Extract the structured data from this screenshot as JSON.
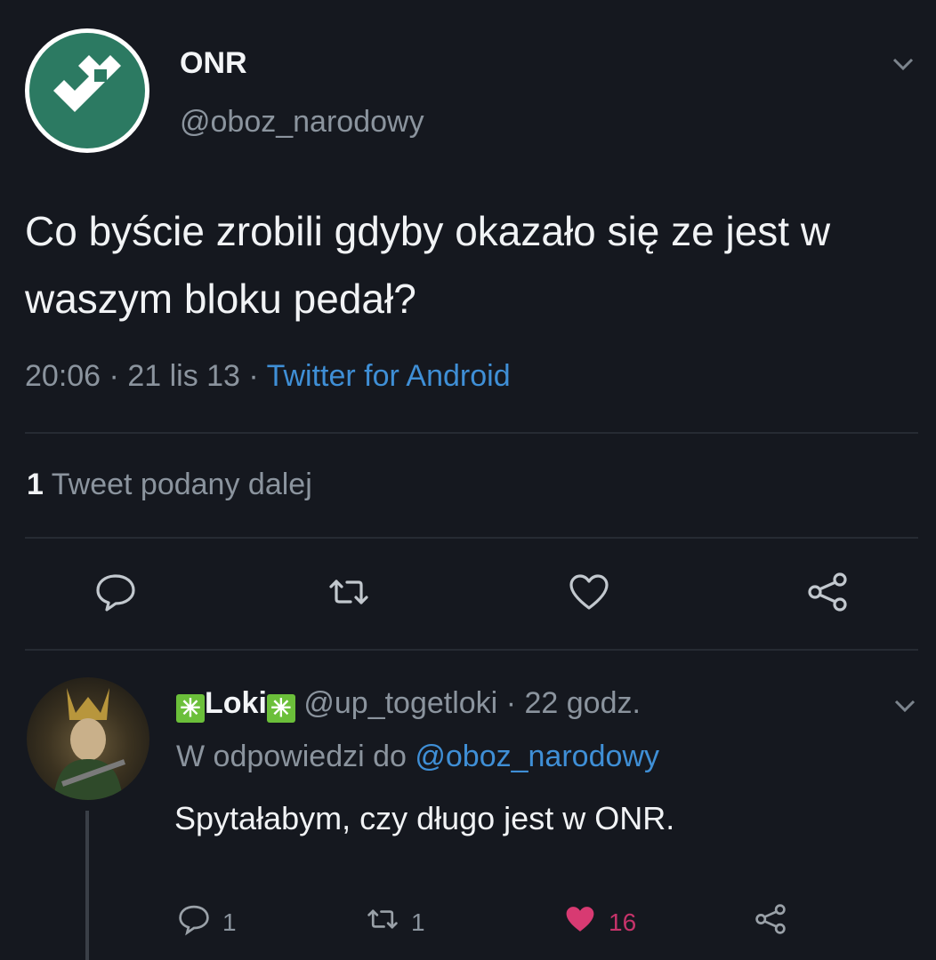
{
  "tweet": {
    "author_name": "ONR",
    "author_handle": "@oboz_narodowy",
    "text": "Co byście zrobili gdyby okazało się ze jest w waszym bloku pedał?",
    "time": "20:06",
    "date": "21 lis 13",
    "separator": "·",
    "source": "Twitter for Android",
    "retweet_count": "1",
    "retweet_label": "Tweet podany dalej"
  },
  "reply": {
    "author_name": "Loki",
    "name_emoji": "✳",
    "author_handle": "@up_togetloki",
    "age": "22 godz.",
    "reply_to_label": "W odpowiedzi do",
    "reply_to_handle": "@oboz_narodowy",
    "text": "Spytałabym, czy długo jest w ONR.",
    "reply_count": "1",
    "retweet_count": "1",
    "like_count": "16"
  },
  "icons": {
    "main_actions": [
      "reply-icon",
      "retweet-icon",
      "like-icon",
      "share-icon"
    ],
    "reply_actions": [
      "reply-icon",
      "retweet-icon",
      "like-icon",
      "share-icon"
    ]
  },
  "colors": {
    "background": "#15181f",
    "link": "#3f8fd6",
    "like_active": "#c6336a",
    "avatar_brand": "#2c7a62"
  }
}
